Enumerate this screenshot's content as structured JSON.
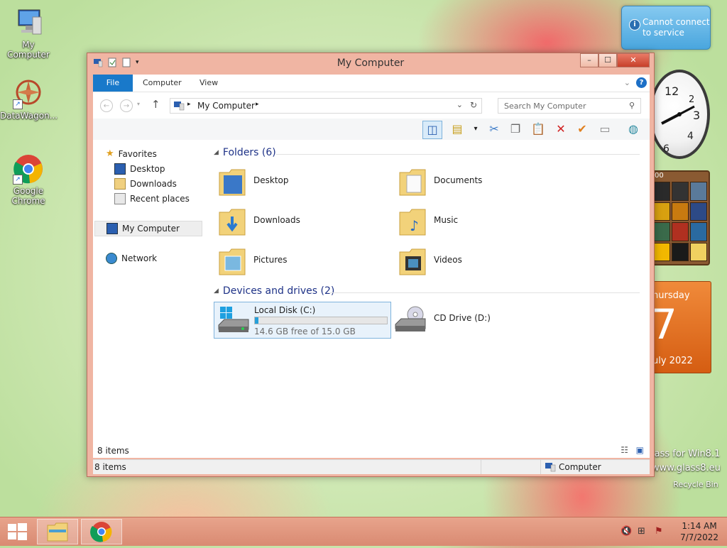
{
  "desktop": {
    "icons": [
      {
        "label": "My Computer"
      },
      {
        "label": "DataWagon..."
      },
      {
        "label": "Google Chrome"
      }
    ],
    "recycle_bin": "Recycle Bin",
    "glass_line1": "lass for Win8.1",
    "glass_line2": "www.glass8.eu"
  },
  "notification": {
    "line1": "Cannot connect",
    "line2": "to service",
    "icon": "info-icon"
  },
  "calendar": {
    "day": "hursday",
    "date": "7",
    "month_year": "uly 2022"
  },
  "puzzle": {
    "time": "00"
  },
  "window": {
    "title": "My Computer",
    "tabs": {
      "file": "File",
      "computer": "Computer",
      "view": "View"
    },
    "address": "My Computer",
    "search_placeholder": "Search My Computer",
    "nav": {
      "favorites": "Favorites",
      "desktop": "Desktop",
      "downloads": "Downloads",
      "recent": "Recent places",
      "my_computer": "My Computer",
      "network": "Network"
    },
    "folders_header": "Folders (6)",
    "folders": [
      "Desktop",
      "Documents",
      "Downloads",
      "Music",
      "Pictures",
      "Videos"
    ],
    "drives_header": "Devices and drives (2)",
    "drives": [
      {
        "name": "Local Disk (C:)",
        "free": "14.6 GB free of 15.0 GB",
        "used_fraction": 0.027
      },
      {
        "name": "CD Drive (D:)"
      }
    ],
    "status_items": "8 items",
    "statusbar_items": "8 items",
    "statusbar_location": "Computer"
  },
  "taskbar": {
    "time": "1:14 AM",
    "date": "7/7/2022"
  },
  "colors": {
    "accent": "#1979ca",
    "drive_fill": "#26a0da",
    "window_frame": "#f0b5a3"
  }
}
